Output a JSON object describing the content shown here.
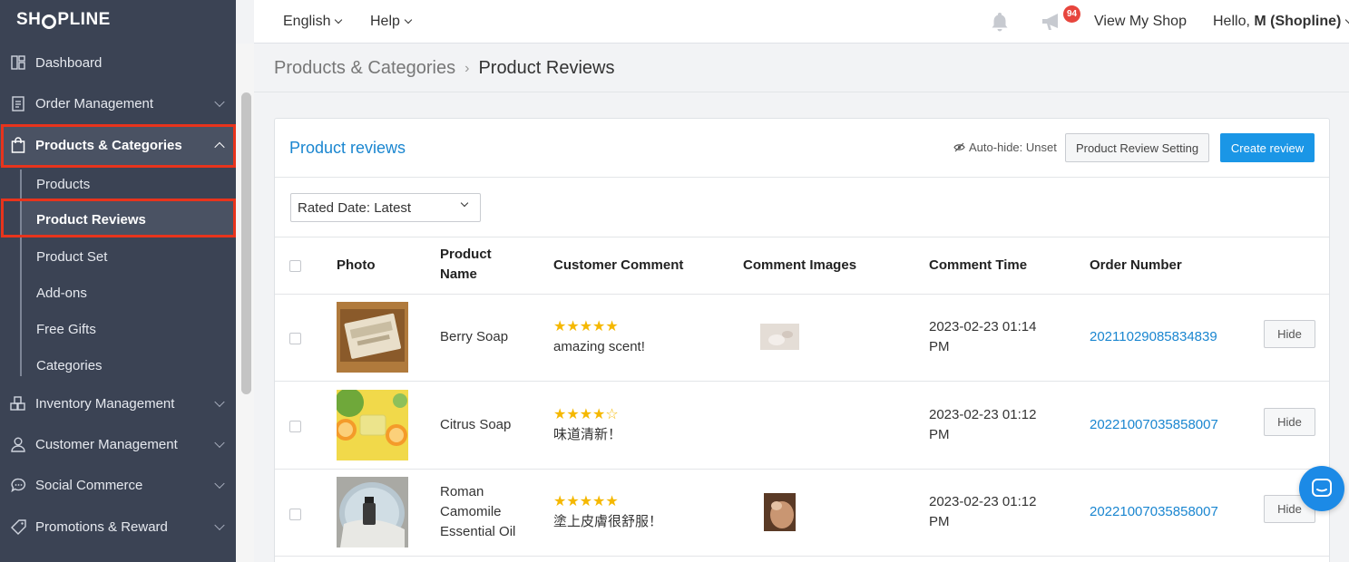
{
  "brand": {
    "logo_pre": "SH",
    "logo_post": "PLINE"
  },
  "sidebar": {
    "items": [
      {
        "label": "Dashboard",
        "icon": "dashboard-icon"
      },
      {
        "label": "Order Management",
        "icon": "order-icon"
      },
      {
        "label": "Products & Categories",
        "icon": "bag-icon"
      },
      {
        "label": "Inventory Management",
        "icon": "inventory-icon"
      },
      {
        "label": "Customer Management",
        "icon": "user-icon"
      },
      {
        "label": "Social Commerce",
        "icon": "chat-bubble-icon"
      },
      {
        "label": "Promotions & Reward",
        "icon": "tag-icon"
      }
    ],
    "sub_items": [
      "Products",
      "Product Reviews",
      "Product Set",
      "Add-ons",
      "Free Gifts",
      "Categories"
    ]
  },
  "topbar": {
    "language": "English",
    "help": "Help",
    "notification_count": "94",
    "view_shop": "View My Shop",
    "greeting": "Hello, ",
    "user": "M (Shopline)"
  },
  "breadcrumb": {
    "parent": "Products & Categories",
    "current": "Product Reviews"
  },
  "panel": {
    "title": "Product reviews",
    "autohide": "Auto-hide: Unset",
    "setting_button": "Product Review Setting",
    "create_button": "Create review",
    "sort_select": "Rated Date: Latest"
  },
  "table": {
    "headers": {
      "photo": "Photo",
      "product_name_1": "Product",
      "product_name_2": "Name",
      "comment": "Customer Comment",
      "images": "Comment Images",
      "time": "Comment Time",
      "order": "Order Number"
    },
    "rows": [
      {
        "name_lines": [
          "Berry Soap"
        ],
        "rating": 5,
        "stars": "★★★★★",
        "comment": "amazing scent!",
        "time_1": "2023-02-23 01:14",
        "time_2": "PM",
        "order": "20211029085834839",
        "hide": "Hide",
        "has_image": true
      },
      {
        "name_lines": [
          "Citrus Soap"
        ],
        "rating": 4,
        "stars": "★★★★☆",
        "comment": "味道清新！",
        "time_1": "2023-02-23 01:12",
        "time_2": "PM",
        "order": "20221007035858007",
        "hide": "Hide",
        "has_image": false
      },
      {
        "name_lines": [
          "Roman",
          "Camomile",
          "Essential Oil"
        ],
        "rating": 5,
        "stars": "★★★★★",
        "comment": "塗上皮膚很舒服！",
        "time_1": "2023-02-23 01:12",
        "time_2": "PM",
        "order": "20221007035858007",
        "hide": "Hide",
        "has_image": true
      }
    ]
  },
  "colors": {
    "sidebar_bg": "#3b4354",
    "accent": "#1a96e6",
    "highlight_box": "#e8341c",
    "star": "#f5b800"
  }
}
